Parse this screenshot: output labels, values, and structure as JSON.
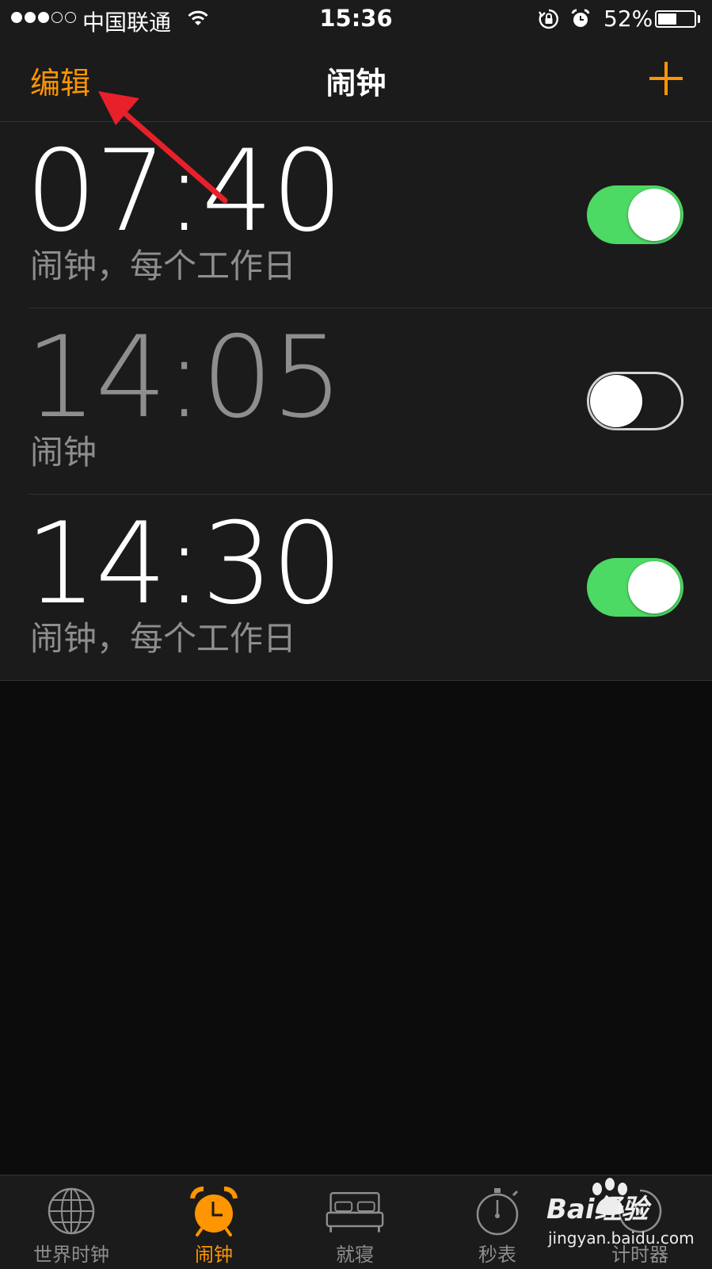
{
  "status_bar": {
    "carrier": "中国联通",
    "time": "15:36",
    "battery_percent": "52%",
    "battery_level": 0.52
  },
  "nav": {
    "edit_label": "编辑",
    "title": "闹钟",
    "add_icon": "plus-icon"
  },
  "alarms": [
    {
      "time": "07:40",
      "label": "闹钟，每个工作日",
      "enabled": true
    },
    {
      "time": "14:05",
      "label": "闹钟",
      "enabled": false
    },
    {
      "time": "14:30",
      "label": "闹钟，每个工作日",
      "enabled": true
    }
  ],
  "tabs": [
    {
      "label": "世界时钟",
      "icon": "globe-icon",
      "active": false
    },
    {
      "label": "闹钟",
      "icon": "alarm-clock-icon",
      "active": true
    },
    {
      "label": "就寝",
      "icon": "bed-icon",
      "active": false
    },
    {
      "label": "秒表",
      "icon": "stopwatch-icon",
      "active": false
    },
    {
      "label": "计时器",
      "icon": "timer-icon",
      "active": false
    }
  ],
  "watermark": {
    "brand": "Bai经验",
    "url": "jingyan.baidu.com"
  },
  "colors": {
    "accent": "#ff9500",
    "toggle_on": "#4cd964",
    "annotation_arrow": "#e8202a"
  }
}
